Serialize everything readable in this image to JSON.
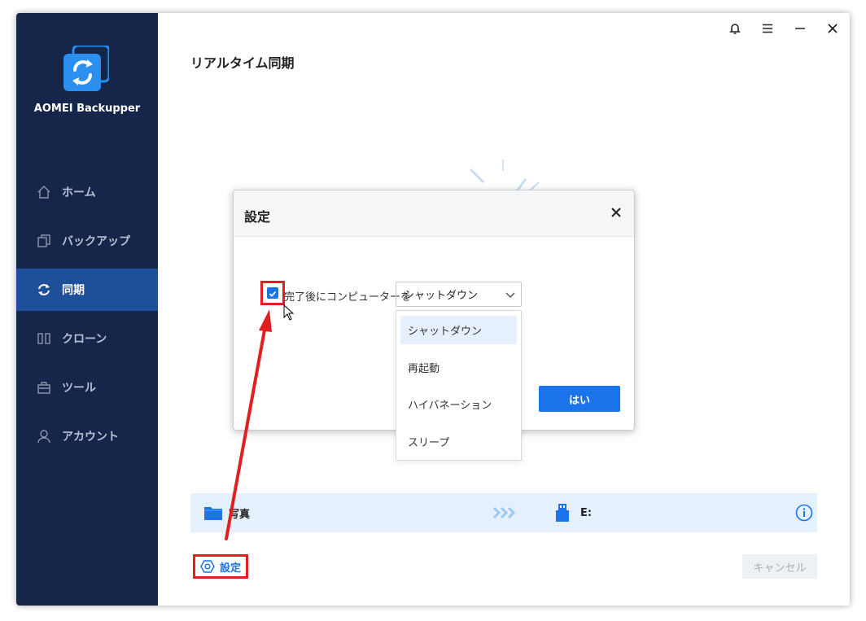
{
  "app": {
    "name": "AOMEI Backupper"
  },
  "sidebar": {
    "items": [
      {
        "label": "ホーム",
        "icon": "home-icon"
      },
      {
        "label": "バックアップ",
        "icon": "copy-icon"
      },
      {
        "label": "同期",
        "icon": "sync-icon",
        "active": true
      },
      {
        "label": "クローン",
        "icon": "clone-icon"
      },
      {
        "label": "ツール",
        "icon": "toolbox-icon"
      },
      {
        "label": "アカウント",
        "icon": "user-icon"
      }
    ]
  },
  "header": {
    "page_title": "リアルタイム同期"
  },
  "sync_task": {
    "source": "写真",
    "destination": "E:"
  },
  "footer": {
    "settings_label": "設定",
    "cancel_label": "キャンセル"
  },
  "dialog": {
    "title": "設定",
    "checkbox_label": "完了後にコンピューターを",
    "checked": true,
    "select_value": "シャットダウン",
    "options": [
      "シャットダウン",
      "再起動",
      "ハイバネーション",
      "スリープ"
    ],
    "ok_label": "はい"
  },
  "colors": {
    "sidebar": "#16264a",
    "active": "#1e4f9a",
    "accent": "#1a73e8",
    "highlight": "#e02020"
  }
}
